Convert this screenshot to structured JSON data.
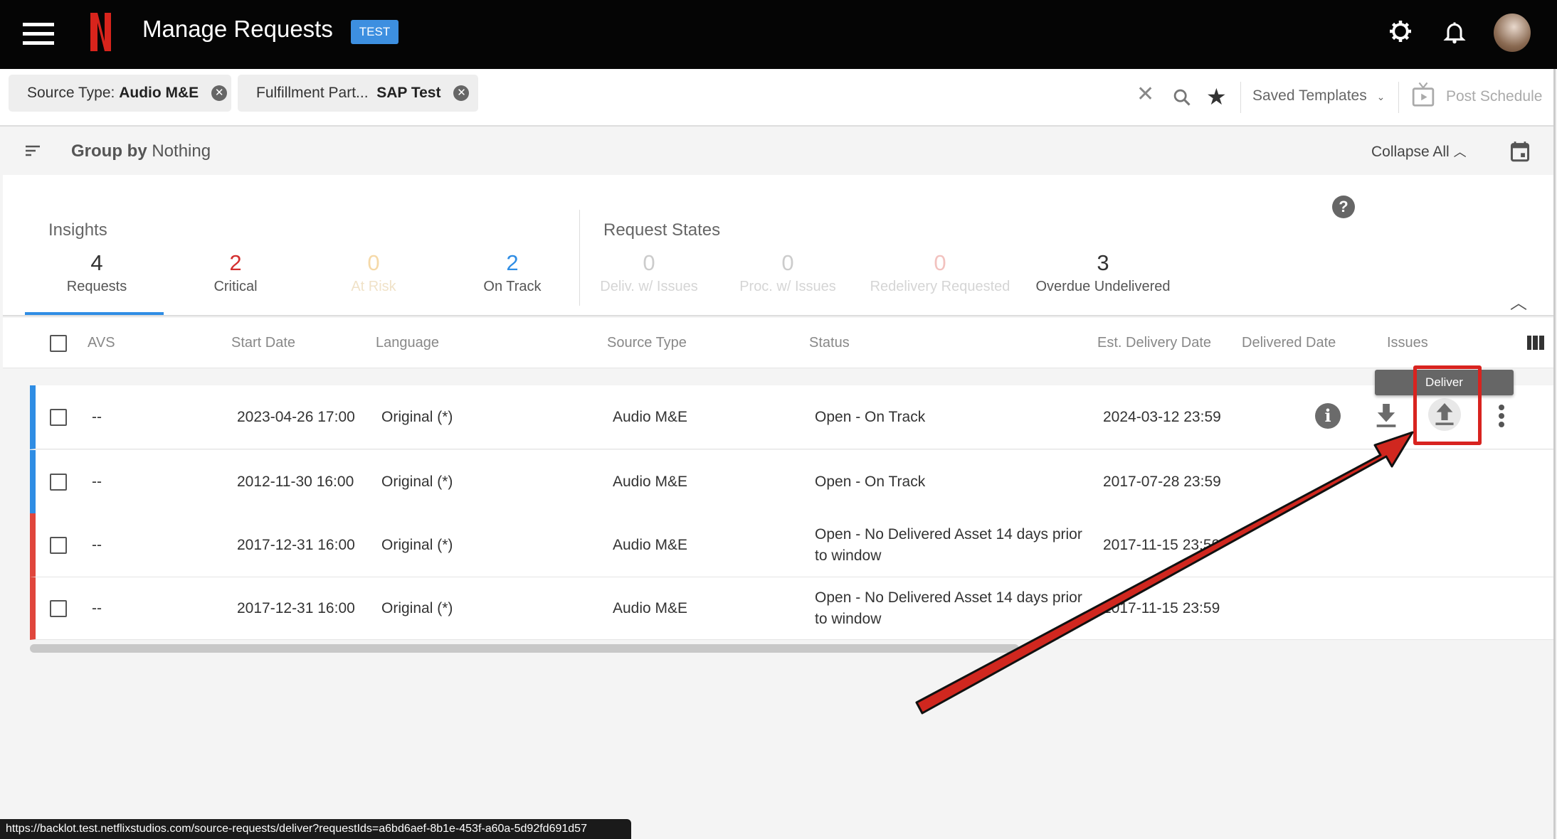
{
  "header": {
    "title": "Manage Requests",
    "env_badge": "TEST",
    "icons": [
      "menu-icon",
      "netflix-logo",
      "gear-icon",
      "bell-icon",
      "avatar"
    ]
  },
  "filters": {
    "chips": [
      {
        "label": "Source Type:",
        "value": "Audio M&E"
      },
      {
        "label": "Fulfillment Part...",
        "value": "SAP Test"
      }
    ],
    "saved_templates": "Saved Templates",
    "post_schedule": "Post Schedule"
  },
  "group_bar": {
    "group_by_label": "Group by",
    "group_by_value": "Nothing",
    "collapse_all": "Collapse All"
  },
  "insights": {
    "title": "Insights",
    "items": [
      {
        "value": "4",
        "label": "Requests",
        "color": "#333333"
      },
      {
        "value": "2",
        "label": "Critical",
        "color": "#d32f2f"
      },
      {
        "value": "0",
        "label": "At Risk",
        "color": "#f5d9a8"
      },
      {
        "value": "2",
        "label": "On Track",
        "color": "#2f8de4"
      }
    ]
  },
  "request_states": {
    "title": "Request States",
    "items": [
      {
        "value": "0",
        "label": "Deliv. w/ Issues"
      },
      {
        "value": "0",
        "label": "Proc. w/ Issues"
      },
      {
        "value": "0",
        "label": "Redelivery Requested"
      },
      {
        "value": "3",
        "label": "Overdue Undelivered"
      }
    ]
  },
  "table": {
    "columns": [
      "AVS",
      "Start Date",
      "Language",
      "Source Type",
      "Status",
      "Est. Delivery Date",
      "Delivered Date",
      "Issues"
    ],
    "rows": [
      {
        "avs": "--",
        "start": "2023-04-26 17:00",
        "language": "Original (*)",
        "source": "Audio M&E",
        "status": "Open - On Track",
        "est": "2024-03-12 23:59",
        "delivered": "",
        "flag": "#2f8de4"
      },
      {
        "avs": "--",
        "start": "2012-11-30 16:00",
        "language": "Original (*)",
        "source": "Audio M&E",
        "status": "Open - On Track",
        "est": "2017-07-28 23:59",
        "delivered": "",
        "flag": "#2f8de4"
      },
      {
        "avs": "--",
        "start": "2017-12-31 16:00",
        "language": "Original (*)",
        "source": "Audio M&E",
        "status": "Open - No Delivered Asset 14 days prior to window",
        "est": "2017-11-15 23:59",
        "delivered": "",
        "flag": "#e0463c"
      },
      {
        "avs": "--",
        "start": "2017-12-31 16:00",
        "language": "Original (*)",
        "source": "Audio M&E",
        "status": "Open - No Delivered Asset 14 days prior to window",
        "est": "2017-11-15 23:59",
        "delivered": "",
        "flag": "#e0463c"
      }
    ]
  },
  "tooltip": "Deliver",
  "status_url": "https://backlot.test.netflixstudios.com/source-requests/deliver?requestIds=a6bd6aef-8b1e-453f-a60a-5d92fd691d57",
  "accent": "#2f8de4"
}
